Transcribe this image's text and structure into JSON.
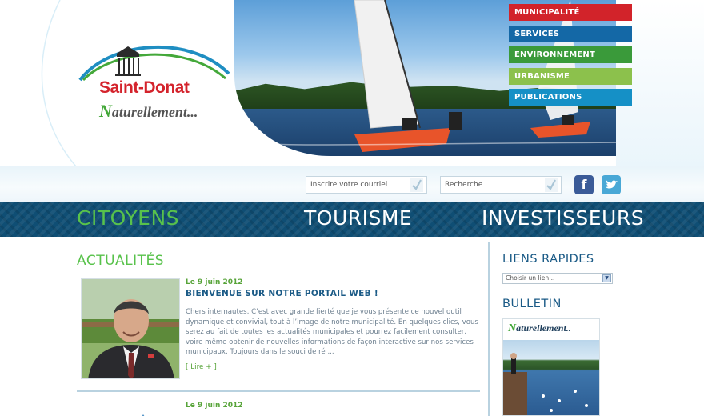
{
  "brand": {
    "name": "Saint-Donat",
    "tagline_first": "N",
    "tagline_rest": "aturellement..."
  },
  "top_nav": [
    {
      "label": "MUNICIPALITÉ",
      "color": "#d2232a"
    },
    {
      "label": "SERVICES",
      "color": "#1468a6"
    },
    {
      "label": "ENVIRONNEMENT",
      "color": "#3a9a3a"
    },
    {
      "label": "URBANISME",
      "color": "#8cc14c"
    },
    {
      "label": "PUBLICATIONS",
      "color": "#1590c6"
    }
  ],
  "toolbar": {
    "newsletter_placeholder": "Inscrire votre courriel",
    "search_placeholder": "Recherche"
  },
  "main_nav": {
    "citoyens": "CITOYENS",
    "tourisme": "TOURISME",
    "investisseurs": "INVESTISSEURS",
    "active_color": "#58c24b"
  },
  "news": {
    "title": "ACTUALITÉS",
    "items": [
      {
        "date": "Le 9 juin 2012",
        "headline": "BIENVENUE SUR NOTRE PORTAIL WEB !",
        "body": "Chers internautes, C’est avec grande fierté que je vous présente ce nouvel outil dynamique et convivial, tout à l’image de notre municipalité. En quelques clics, vous serez au fait de toutes les actualités municipales et pourrez facilement consulter, voire même obtenir de nouvelles informations de façon interactive sur nos services municipaux. Toujours dans le souci de ré ...",
        "more": "[ Lire + ]"
      },
      {
        "date": "Le 9 juin 2012"
      }
    ]
  },
  "sidebar": {
    "quick_links_title": "LIENS RAPIDES",
    "quick_links_selected": "Choisir un lien...",
    "bulletin_title": "BULLETIN",
    "bulletin_brand_first": "N",
    "bulletin_brand_rest": "aturellement.."
  },
  "icons": {
    "facebook": "facebook-icon",
    "twitter": "twitter-icon",
    "check": "check-icon",
    "dropdown": "chevron-down-icon"
  }
}
